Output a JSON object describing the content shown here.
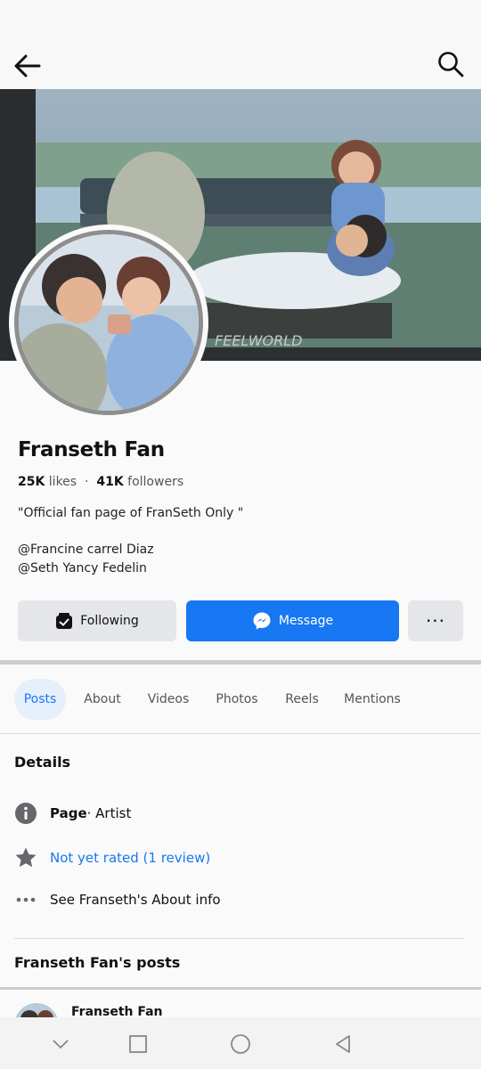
{
  "page": {
    "name": "Franseth Fan",
    "likes_count": "25K",
    "likes_label": "likes",
    "followers_count": "41K",
    "followers_label": "followers",
    "bio_quote": "\"Official fan page of FranSeth Only \"",
    "bio_mentions": [
      "@Francine carrel Diaz",
      "@Seth Yancy Fedelin"
    ],
    "cover_watermark": "FEELWORLD"
  },
  "buttons": {
    "following_label": "Following",
    "message_label": "Message",
    "more_label": "···"
  },
  "tabs": [
    {
      "label": "Posts",
      "active": true
    },
    {
      "label": "About"
    },
    {
      "label": "Videos"
    },
    {
      "label": "Photos"
    },
    {
      "label": "Reels"
    },
    {
      "label": "Mentions"
    }
  ],
  "details": {
    "heading": "Details",
    "category_bold": "Page",
    "category_rest": " · Artist",
    "rating_link": "Not yet rated (1 review)",
    "about_link": "See Franseth's About info"
  },
  "posts": {
    "heading": "Franseth Fan's posts",
    "first_author": "Franseth Fan"
  },
  "colors": {
    "accent": "#1877f2",
    "button_grey": "#e4e6ea",
    "divider": "#c9ccd0"
  },
  "icons": {
    "back": "arrow-left-icon",
    "search": "search-icon",
    "following": "following-check-icon",
    "message": "messenger-icon",
    "info": "info-icon",
    "star": "star-icon",
    "more": "more-dots-icon"
  }
}
